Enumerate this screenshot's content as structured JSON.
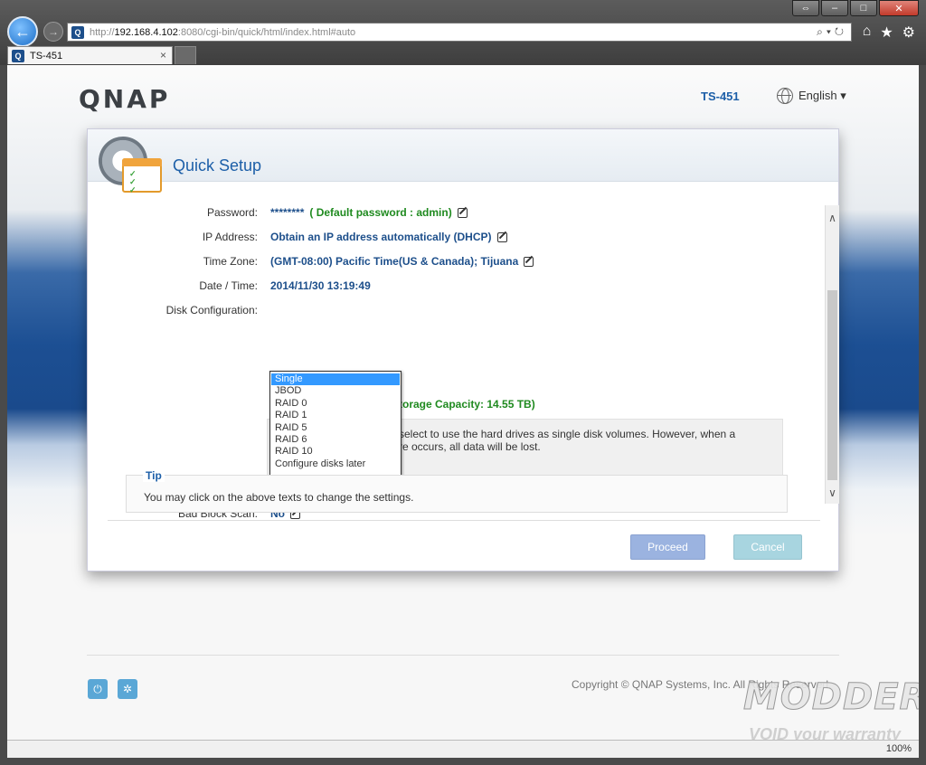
{
  "browser": {
    "url_scheme": "http://",
    "url_host": "192.168.4.102",
    "url_rest": ":8080/cgi-bin/quick/html/index.html#auto",
    "tab_title": "TS-451",
    "tab_close": "×",
    "zoom": "100%"
  },
  "header": {
    "logo": "QNAP",
    "model": "TS-451",
    "language": "English ▾"
  },
  "dialog": {
    "title": "Quick Setup",
    "fields": {
      "password_label": "Password:",
      "password_value": "********",
      "password_note": "( Default password  :  admin)",
      "ip_label": "IP Address:",
      "ip_value": "Obtain an IP address automatically (DHCP)",
      "timezone_label": "Time Zone:",
      "timezone_value": "(GMT-08:00) Pacific Time(US & Canada); Tijuana",
      "datetime_label": "Date / Time:",
      "datetime_value": "2014/11/30 13:19:49",
      "disk_label": "Disk Configuration:",
      "capacity_text": "torage Capacity: 14.55 TB)",
      "info_line1": "select to use the hard drives as single disk volumes. However, when a",
      "info_line2": "re occurs, all data will be lost.",
      "badblock_label": "Bad Block Scan:",
      "badblock_value": "No"
    },
    "disk_options": [
      "Single",
      "JBOD",
      "RAID 0",
      "RAID 1",
      "RAID 5",
      "RAID 6",
      "RAID 10",
      "Configure disks later"
    ],
    "selected_option": "Single",
    "tip_title": "Tip",
    "tip_text": "You may click on the above texts to change the settings.",
    "proceed_label": "Proceed",
    "cancel_label": "Cancel"
  },
  "footer": {
    "copyright": "Copyright © QNAP Systems, Inc. All Rights Reserved."
  },
  "watermark": {
    "main": "MODDERS",
    "sub": "VOID your warranty"
  },
  "colors": {
    "accent": "#1d5fa8",
    "success": "#1f8a1f",
    "selected": "#3399ff"
  }
}
